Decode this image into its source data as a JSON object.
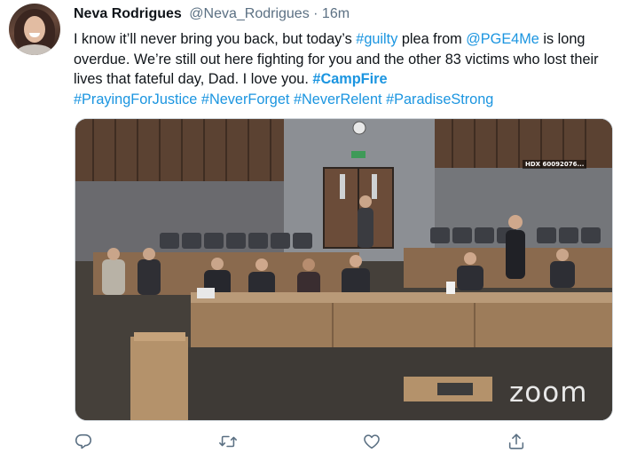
{
  "tweet": {
    "author": {
      "display_name": "Neva Rodrigues",
      "handle": "@Neva_Rodrigues",
      "separator": "·",
      "timestamp": "16m"
    },
    "body": {
      "t1": "I know it’ll never bring you back, but today’s ",
      "tag_guilty": "#guilty",
      "t2": " plea from ",
      "mention": "@PGE4Me",
      "t3": " is long overdue. We’re still out here fighting for you and the other 83 victims who lost their lives that fateful day, Dad. I love you. ",
      "tag_campfire": "#CampFire",
      "tag_praying": "#PrayingForJustice",
      "tag_neverforget": "#NeverForget",
      "tag_neverrelent": "#NeverRelent",
      "tag_paradise": "#ParadiseStrong"
    },
    "media": {
      "overlay_id": "HDX 60092076...",
      "zoom_watermark": "zoom"
    },
    "actions": {
      "reply_icon": "reply-icon",
      "retweet_icon": "retweet-icon",
      "like_icon": "heart-icon",
      "share_icon": "share-icon"
    },
    "colors": {
      "link": "#1b95e0",
      "secondary_text": "#5b7083",
      "primary_text": "#0f1419",
      "icon": "#5b7083"
    }
  }
}
